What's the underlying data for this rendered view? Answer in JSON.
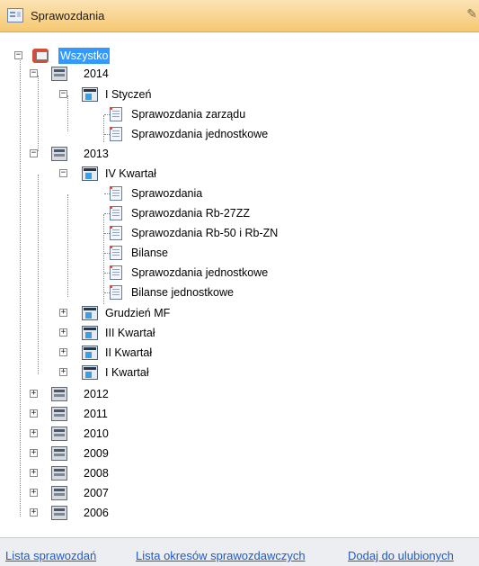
{
  "panel": {
    "title": "Sprawozdania"
  },
  "tree": {
    "root": "Wszystko",
    "nodes": [
      {
        "label": "2014"
      },
      {
        "label": "I Styczeń"
      },
      {
        "label": "Sprawozdania zarządu"
      },
      {
        "label": "Sprawozdania jednostkowe"
      },
      {
        "label": "2013"
      },
      {
        "label": "IV Kwartał"
      },
      {
        "label": "Sprawozdania"
      },
      {
        "label": "Sprawozdania Rb-27ZZ"
      },
      {
        "label": "Sprawozdania Rb-50 i Rb-ZN"
      },
      {
        "label": "Bilanse"
      },
      {
        "label": "Sprawozdania jednostkowe"
      },
      {
        "label": "Bilanse jednostkowe"
      },
      {
        "label": "Grudzień MF"
      },
      {
        "label": "III Kwartał"
      },
      {
        "label": "II Kwartał"
      },
      {
        "label": "I Kwartał"
      },
      {
        "label": "2012"
      },
      {
        "label": "2011"
      },
      {
        "label": "2010"
      },
      {
        "label": "2009"
      },
      {
        "label": "2008"
      },
      {
        "label": "2007"
      },
      {
        "label": "2006"
      }
    ]
  },
  "footer": {
    "links": [
      "Lista sprawozdań",
      "Lista okresów sprawozdawczych",
      "Dodaj do ulubionych"
    ]
  }
}
